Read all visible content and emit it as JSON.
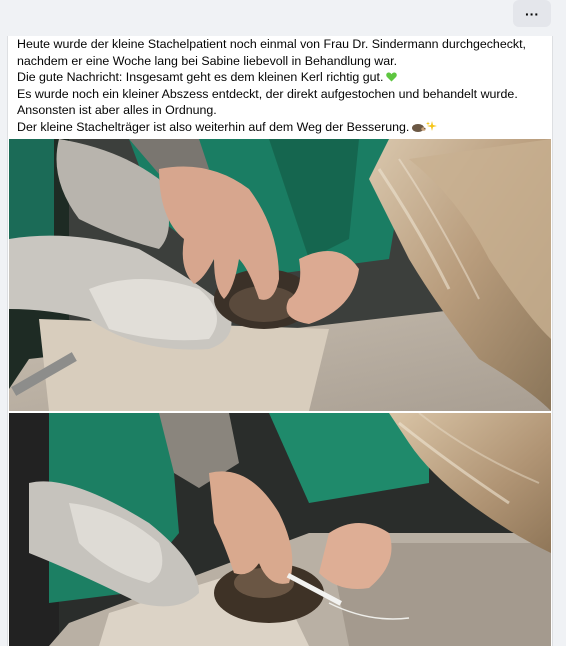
{
  "toolbar": {
    "more_label": "···",
    "more_icon": "more-horizontal-icon"
  },
  "post": {
    "lines": [
      "Heute wurde der kleine Stachelpatient noch einmal von Frau Dr. Sindermann durchgecheckt,",
      "nachdem er eine Woche lang bei Sabine liebevoll in Behandlung war.",
      "Die gute Nachricht: Insgesamt geht es dem kleinen Kerl richtig gut.",
      "Es wurde noch ein kleiner Abszess entdeckt, der direkt aufgestochen und behandelt wurde.",
      "Ansonsten ist aber alles in Ordnung.",
      "Der kleine Stachelträger ist also weiterhin auf dem Weg der Besserung."
    ],
    "emojis": [
      "green-heart-icon",
      "hedgehog-icon",
      "sparkles-icon"
    ]
  },
  "photos": [
    {
      "name": "photo-hedgehog-examination-1",
      "description_visible": false
    },
    {
      "name": "photo-hedgehog-examination-2",
      "description_visible": false
    }
  ],
  "colors": {
    "background": "#f0f2f5",
    "card": "#ffffff",
    "button": "#e4e6eb",
    "text": "#050505",
    "heart": "#5ec640"
  }
}
